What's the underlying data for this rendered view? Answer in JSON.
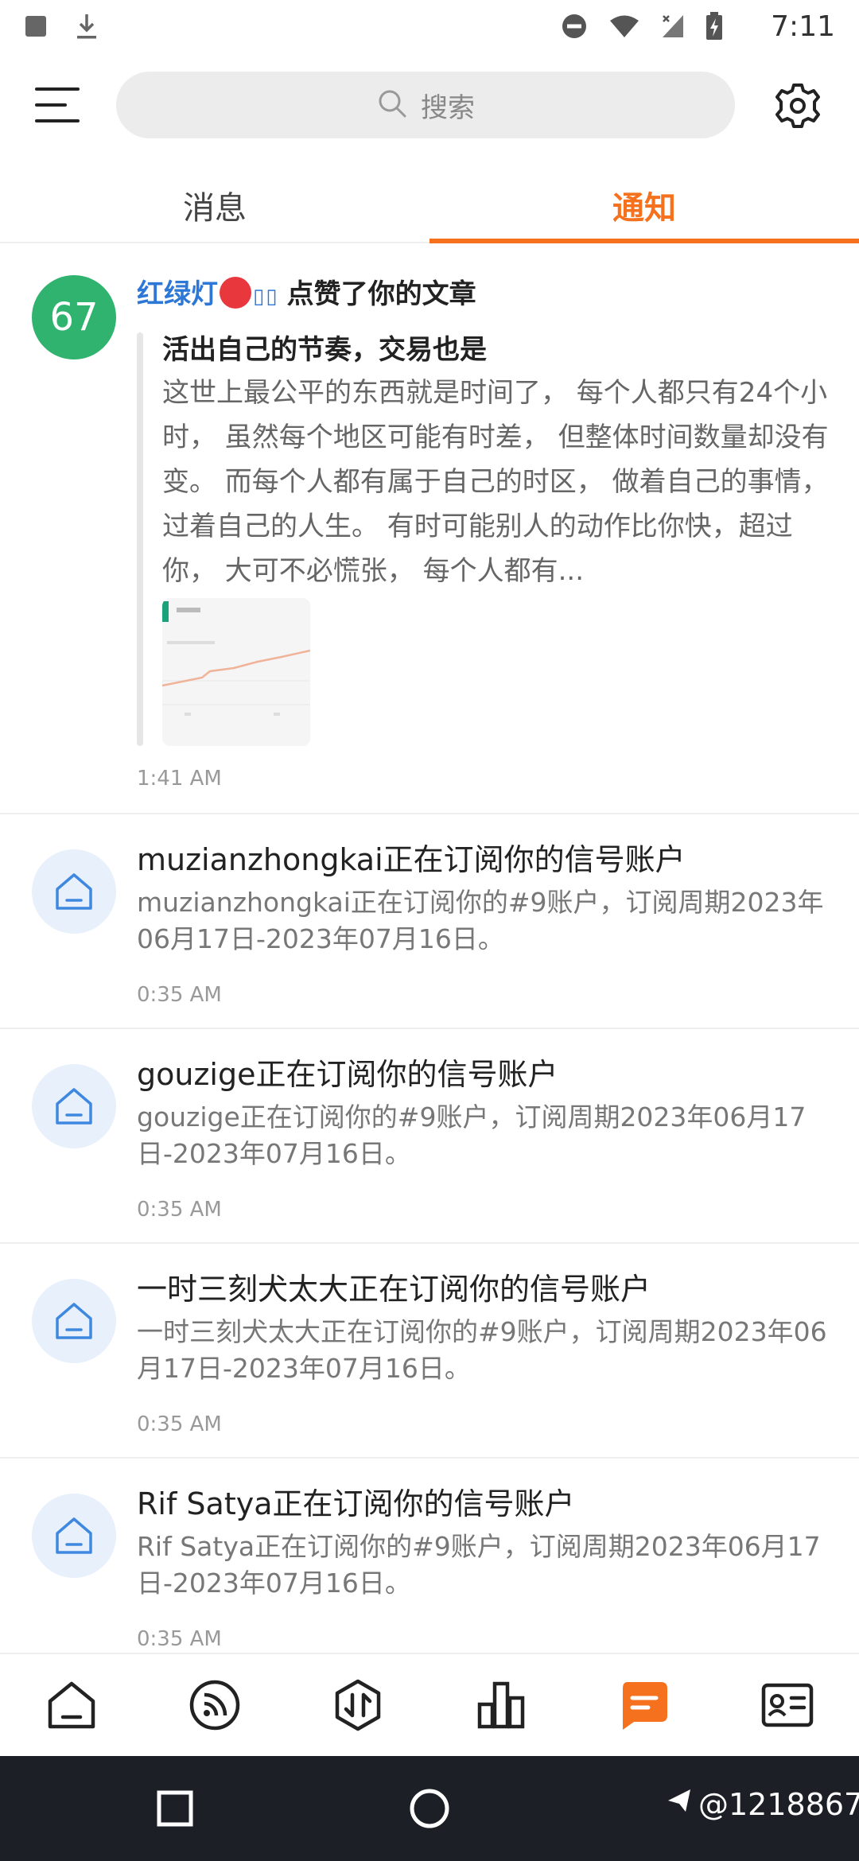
{
  "status_bar": {
    "time": "7:11",
    "icons": [
      "square-notification-icon",
      "download-icon",
      "do-not-disturb-icon",
      "wifi-icon",
      "signal-icon",
      "battery-charging-icon"
    ]
  },
  "header": {
    "search_placeholder": "搜索",
    "icons": [
      "menu-icon",
      "search-icon",
      "settings-gear-icon"
    ]
  },
  "tabs": [
    {
      "label": "消息",
      "active": false
    },
    {
      "label": "通知",
      "active": true
    }
  ],
  "accent_color": "#f5711d",
  "notifications": {
    "like": {
      "avatar_text": "67",
      "user": "红绿灯",
      "action": "点赞了你的文章",
      "article_title": "活出自己的节奏，交易也是",
      "article_excerpt": "这世上最公平的东西就是时间了， 每个人都只有24个小时， 虽然每个地区可能有时差， 但整体时间数量却没有变。 而每个人都有属于自己的时区， 做着自己的事情，过着自己的人生。 有时可能别人的动作比你快，超过你， 大可不必慌张， 每个人都有...",
      "time": "1:41 AM"
    },
    "subscriptions": [
      {
        "title": "muzianzhongkai正在订阅你的信号账户",
        "body": "muzianzhongkai正在订阅你的#9账户，订阅周期2023年06月17日-2023年07月16日。",
        "time": "0:35 AM"
      },
      {
        "title": "gouzige正在订阅你的信号账户",
        "body": "gouzige正在订阅你的#9账户，订阅周期2023年06月17日-2023年07月16日。",
        "time": "0:35 AM"
      },
      {
        "title": "一时三刻犬太大正在订阅你的信号账户",
        "body": "一时三刻犬太大正在订阅你的#9账户，订阅周期2023年06月17日-2023年07月16日。",
        "time": "0:35 AM"
      },
      {
        "title": "Rif Satya正在订阅你的信号账户",
        "body": "Rif Satya正在订阅你的#9账户，订阅周期2023年06月17日-2023年07月16日。",
        "time": "0:35 AM"
      }
    ]
  },
  "bottom_nav": {
    "items": [
      "home-icon",
      "feed-icon",
      "trade-icon",
      "chart-icon",
      "messages-icon",
      "profile-card-icon"
    ],
    "active": "messages-icon"
  },
  "watermark": "@1218867"
}
